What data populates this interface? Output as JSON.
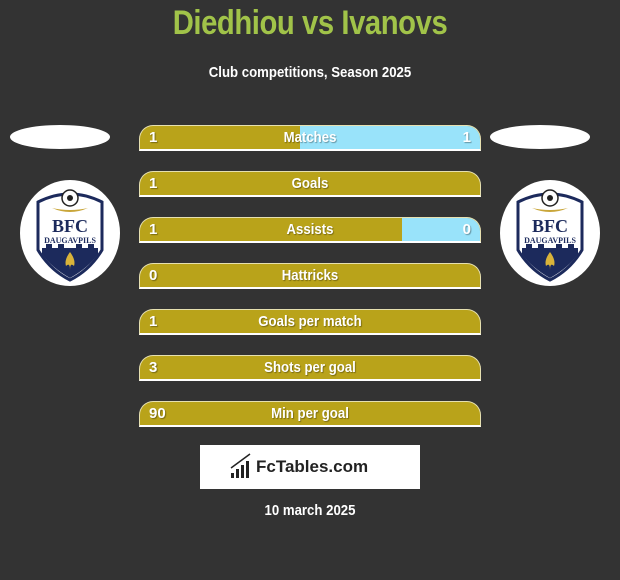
{
  "header": {
    "title": "Diedhiou vs Ivanovs",
    "subtitle": "Club competitions, Season 2025"
  },
  "teams": {
    "left": {
      "crest_line1": "BFC",
      "crest_line2": "DAUGAVPILS"
    },
    "right": {
      "crest_line1": "BFC",
      "crest_line2": "DAUGAVPILS"
    }
  },
  "colors": {
    "title": "#a1c349",
    "left_bar": "#b9a31a",
    "right_bar": "#99e3fa",
    "background": "#333333"
  },
  "stats": [
    {
      "label": "Matches",
      "left": "1",
      "right": "1",
      "right_share": 0.53
    },
    {
      "label": "Goals",
      "left": "1",
      "right": "",
      "right_share": 0
    },
    {
      "label": "Assists",
      "left": "1",
      "right": "0",
      "right_share": 0.23
    },
    {
      "label": "Hattricks",
      "left": "0",
      "right": "",
      "right_share": 0
    },
    {
      "label": "Goals per match",
      "left": "1",
      "right": "",
      "right_share": 0
    },
    {
      "label": "Shots per goal",
      "left": "3",
      "right": "",
      "right_share": 0
    },
    {
      "label": "Min per goal",
      "left": "90",
      "right": "",
      "right_share": 0
    }
  ],
  "footer": {
    "brand": "FcTables.com",
    "date": "10 march 2025"
  }
}
